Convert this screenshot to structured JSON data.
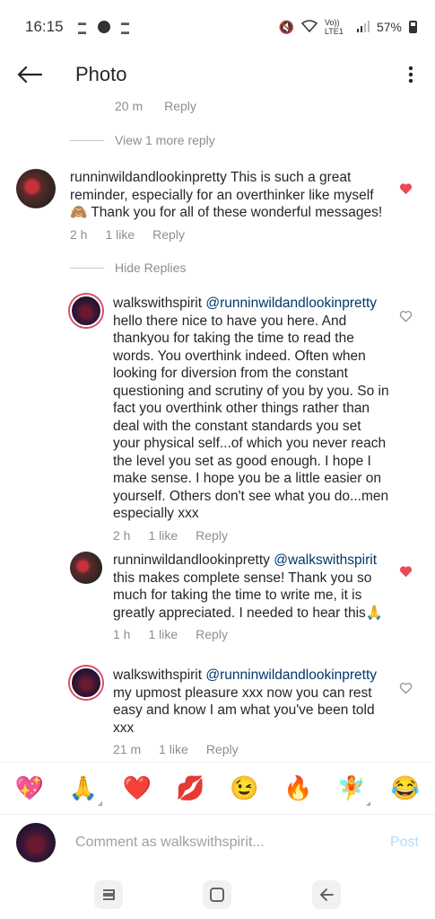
{
  "status_bar": {
    "time": "16:15",
    "icons": [
      "news-icon",
      "circle-icon",
      "news-icon"
    ],
    "network": "Vo)) LTE1",
    "battery": "57%"
  },
  "header": {
    "title": "Photo"
  },
  "partial_comment": {
    "time": "20 m",
    "reply": "Reply"
  },
  "view_more": "View 1 more reply",
  "hide_replies": "Hide Replies",
  "comments": [
    {
      "username": "runninwildandlookinpretty",
      "text": " This is such a great reminder, especially for an overthinker like myself🙈 Thank you for all of these wonderful messages!",
      "mention": "",
      "time": "2 h",
      "likes": "1 like",
      "reply": "Reply",
      "liked": true
    },
    {
      "username": "walkswithspirit",
      "mention": "@runninwildandlookinpretty",
      "text": " hello there nice to have you here.  And thankyou for taking the time to read the words.  You overthink indeed.  Often when looking for diversion from the constant questioning and scrutiny of you by you.  So in fact you overthink other things rather than deal with the constant standards you set your physical self...of which you never reach the level you set as good enough. I hope I make sense.  I hope you be a little easier on yourself.  Others don't see what you do...men especially xxx",
      "time": "2 h",
      "likes": "1 like",
      "reply": "Reply",
      "liked": false
    },
    {
      "username": "runninwildandlookinpretty",
      "mention": "@walkswithspirit",
      "text": " this makes complete sense! Thank you so much for taking the time to write me, it is greatly appreciated. I needed to hear this🙏",
      "time": "1 h",
      "likes": "1 like",
      "reply": "Reply",
      "liked": true
    },
    {
      "username": "walkswithspirit",
      "mention": "@runninwildandlookinpretty",
      "text": " my upmost pleasure xxx now you can rest easy and know I am what you've been told xxx",
      "time": "21 m",
      "likes": "1 like",
      "reply": "Reply",
      "liked": false
    }
  ],
  "emoji_bar": [
    "💖",
    "🙏",
    "❤️",
    "💋",
    "😉",
    "🔥",
    "🧚",
    "😂"
  ],
  "composer": {
    "placeholder": "Comment as walkswithspirit...",
    "post_label": "Post"
  },
  "colors": {
    "like_red": "#ed4956",
    "mention_blue": "#00376b",
    "post_disabled": "#b3dbff"
  }
}
